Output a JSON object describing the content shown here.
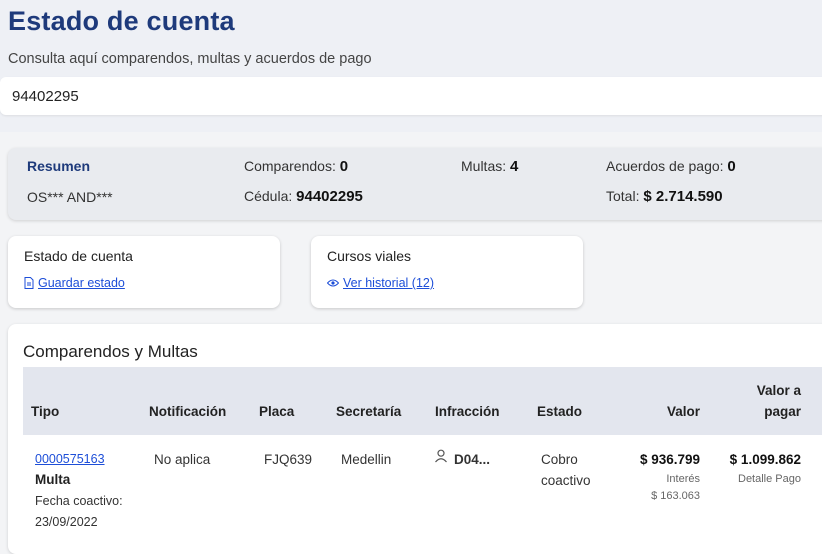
{
  "header": {
    "title": "Estado de cuenta",
    "subtitle": "Consulta aquí comparendos, multas y acuerdos de pago",
    "search_value": "94402295"
  },
  "summary": {
    "resumen_label": "Resumen",
    "name": "OS*** AND***",
    "comparendos_label": "Comparendos:",
    "comparendos_value": "0",
    "multas_label": "Multas:",
    "multas_value": "4",
    "acuerdos_label": "Acuerdos de pago:",
    "acuerdos_value": "0",
    "cedula_label": "Cédula:",
    "cedula_value": "94402295",
    "total_label": "Total:",
    "total_value": "$ 2.714.590"
  },
  "cards": {
    "estado": {
      "title": "Estado de cuenta",
      "link": "Guardar estado",
      "icon": "document-icon"
    },
    "cursos": {
      "title": "Cursos viales",
      "link": "Ver historial (12)",
      "icon": "eye-icon"
    }
  },
  "table": {
    "section_title": "Comparendos y Multas",
    "headers": {
      "tipo": "Tipo",
      "notificacion": "Notificación",
      "placa": "Placa",
      "secretaria": "Secretaría",
      "infraccion": "Infracción",
      "estado": "Estado",
      "valor": "Valor",
      "valor_pagar_1": "Valor a",
      "valor_pagar_2": "pagar"
    },
    "rows": [
      {
        "numero": "0000575163",
        "tipo": "Multa",
        "fecha_label": "Fecha coactivo:",
        "fecha": "23/09/2022",
        "notificacion": "No aplica",
        "placa": "FJQ639",
        "secretaria": "Medellin",
        "infraccion": "D04...",
        "estado_1": "Cobro",
        "estado_2": "coactivo",
        "valor": "$ 936.799",
        "interes_label": "Interés",
        "interes": "$ 163.063",
        "valor_pagar": "$ 1.099.862",
        "detalle": "Detalle Pago"
      }
    ]
  }
}
